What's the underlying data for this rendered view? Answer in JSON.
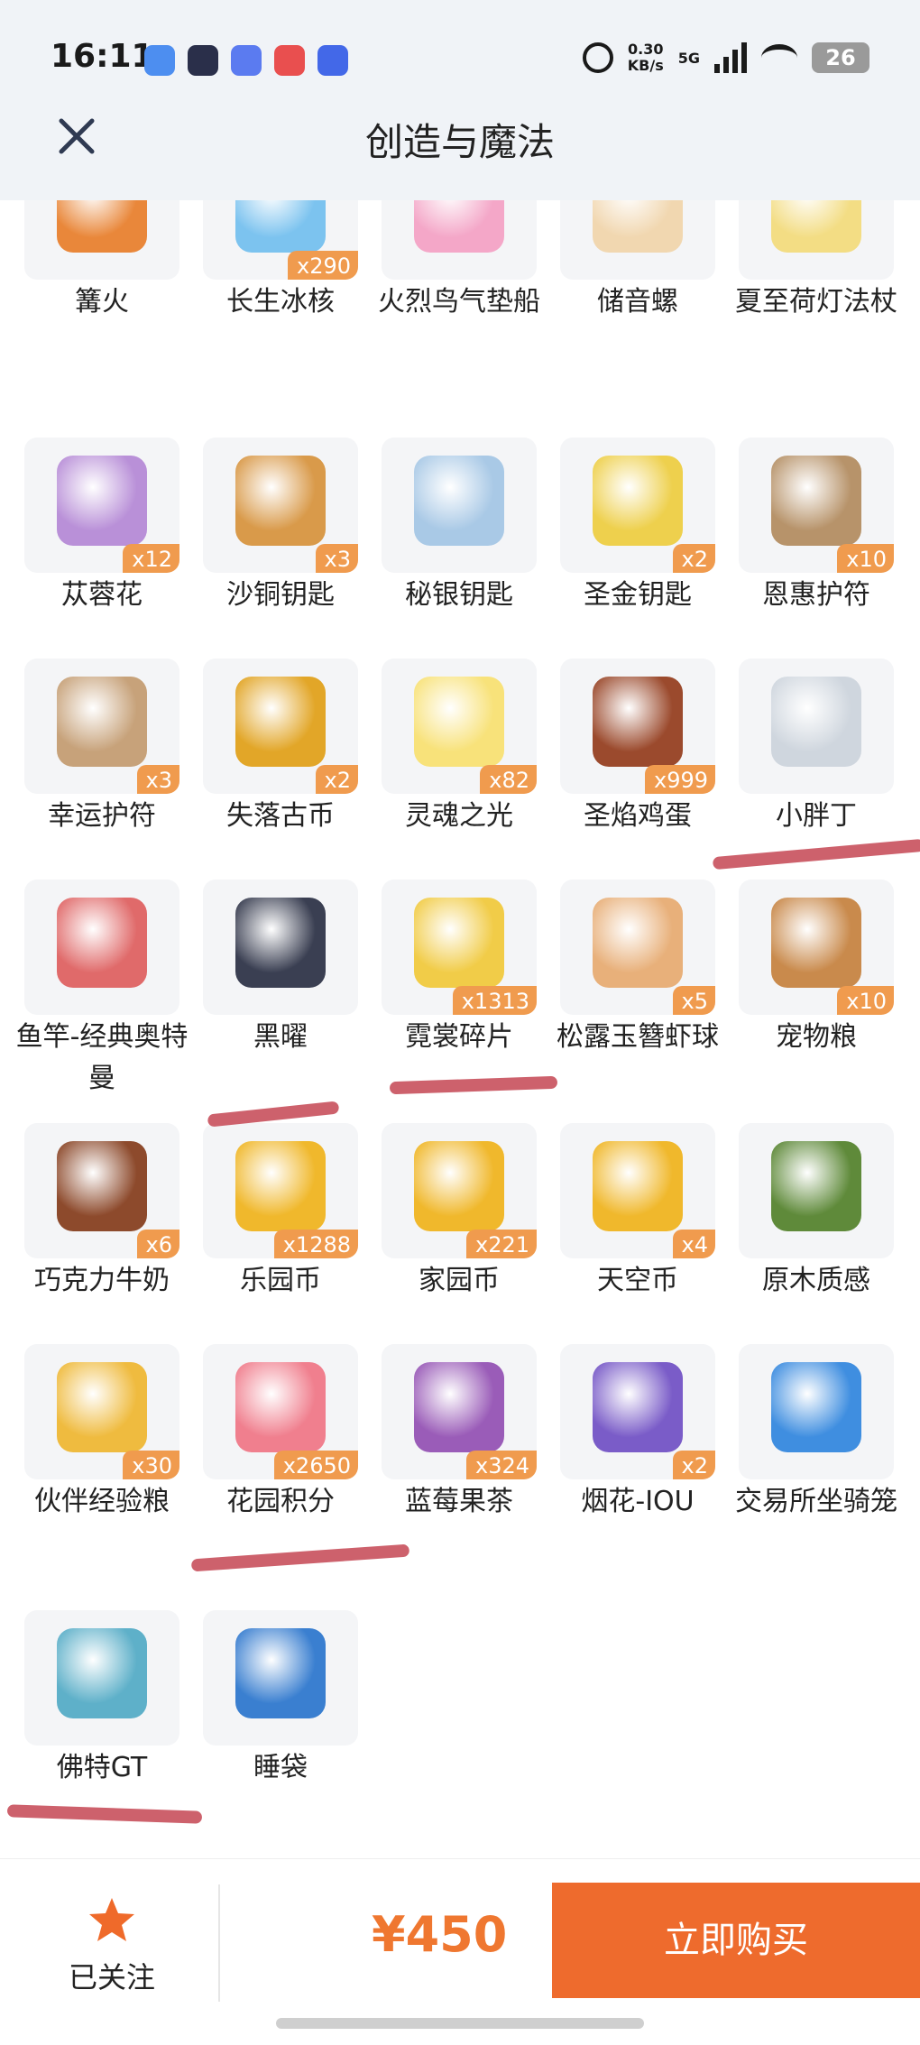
{
  "status_bar": {
    "time": "16:11",
    "speed": "0.30",
    "speed_unit": "KB/s",
    "network": "5G",
    "battery": "26"
  },
  "header": {
    "title": "创造与魔法"
  },
  "items": [
    {
      "name": "篝火",
      "qty": "",
      "color": "#e9873a"
    },
    {
      "name": "长生冰核",
      "qty": "x290",
      "color": "#7cc3ef"
    },
    {
      "name": "火烈鸟气垫船",
      "qty": "",
      "color": "#f4a7c8"
    },
    {
      "name": "储音螺",
      "qty": "",
      "color": "#f1d7b0"
    },
    {
      "name": "夏至荷灯法杖",
      "qty": "",
      "color": "#f3dd84"
    },
    {
      "name": "苁蓉花",
      "qty": "x12",
      "color": "#b990d8"
    },
    {
      "name": "沙铜钥匙",
      "qty": "x3",
      "color": "#d99a4a"
    },
    {
      "name": "秘银钥匙",
      "qty": "",
      "color": "#a9c9e6"
    },
    {
      "name": "圣金钥匙",
      "qty": "x2",
      "color": "#eed04d"
    },
    {
      "name": "恩惠护符",
      "qty": "x10",
      "color": "#b7936a"
    },
    {
      "name": "幸运护符",
      "qty": "x3",
      "color": "#c7a27a"
    },
    {
      "name": "失落古币",
      "qty": "x2",
      "color": "#e2a628"
    },
    {
      "name": "灵魂之光",
      "qty": "x82",
      "color": "#f8e27a"
    },
    {
      "name": "圣焰鸡蛋",
      "qty": "x999",
      "color": "#9b4a2d"
    },
    {
      "name": "小胖丁",
      "qty": "",
      "color": "#cfd6de"
    },
    {
      "name": "鱼竿-经典奥特曼",
      "qty": "",
      "color": "#e06a6a"
    },
    {
      "name": "黑曜",
      "qty": "",
      "color": "#3a3f52"
    },
    {
      "name": "霓裳碎片",
      "qty": "x1313",
      "color": "#f1cc48"
    },
    {
      "name": "松露玉簪虾球",
      "qty": "x5",
      "color": "#e8b07a"
    },
    {
      "name": "宠物粮",
      "qty": "x10",
      "color": "#c98a4c"
    },
    {
      "name": "巧克力牛奶",
      "qty": "x6",
      "color": "#8d4a2c"
    },
    {
      "name": "乐园币",
      "qty": "x1288",
      "color": "#f0b82c"
    },
    {
      "name": "家园币",
      "qty": "x221",
      "color": "#f0b82c"
    },
    {
      "name": "天空币",
      "qty": "x4",
      "color": "#f0b82c"
    },
    {
      "name": "原木质感",
      "qty": "",
      "color": "#5f8a3a"
    },
    {
      "name": "伙伴经验粮",
      "qty": "x30",
      "color": "#efbb3f"
    },
    {
      "name": "花园积分",
      "qty": "x2650",
      "color": "#f07f8e"
    },
    {
      "name": "蓝莓果茶",
      "qty": "x324",
      "color": "#9a5cb8"
    },
    {
      "name": "烟花-IOU",
      "qty": "x2",
      "color": "#7a5cc8"
    },
    {
      "name": "交易所坐骑笼",
      "qty": "",
      "color": "#3f8ee0"
    },
    {
      "name": "佛特GT",
      "qty": "",
      "color": "#5eb0c9"
    },
    {
      "name": "睡袋",
      "qty": "",
      "color": "#3a7fd0"
    }
  ],
  "bottom_bar": {
    "follow_label": "已关注",
    "price": "¥450",
    "buy_label": "立即购买"
  },
  "colors": {
    "accent": "#ee6b2d",
    "price": "#ef7730",
    "qty_badge": "#f09b4e",
    "marker": "#c9545f"
  }
}
